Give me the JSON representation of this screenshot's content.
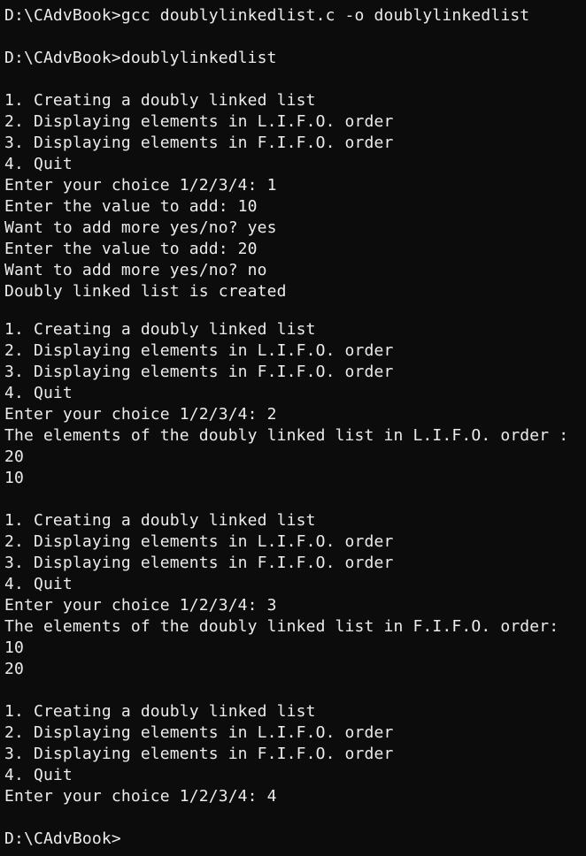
{
  "terminal": {
    "background": "#0c0c0c",
    "foreground": "#ececec",
    "lines": [
      "D:\\CAdvBook>gcc doublylinkedlist.c -o doublylinkedlist",
      "D:\\CAdvBook>doublylinkedlist",
      "1. Creating a doubly linked list",
      "2. Displaying elements in L.I.F.O. order",
      "3. Displaying elements in F.I.F.O. order",
      "4. Quit",
      "Enter your choice 1/2/3/4: 1",
      "Enter the value to add: 10",
      "Want to add more yes/no? yes",
      "Enter the value to add: 20",
      "Want to add more yes/no? no",
      "Doubly linked list is created",
      "1. Creating a doubly linked list",
      "2. Displaying elements in L.I.F.O. order",
      "3. Displaying elements in F.I.F.O. order",
      "4. Quit",
      "Enter your choice 1/2/3/4: 2",
      "The elements of the doubly linked list in L.I.F.O. order :",
      "20",
      "10",
      "1. Creating a doubly linked list",
      "2. Displaying elements in L.I.F.O. order",
      "3. Displaying elements in F.I.F.O. order",
      "4. Quit",
      "Enter your choice 1/2/3/4: 3",
      "The elements of the doubly linked list in F.I.F.O. order:",
      "10",
      "20",
      "1. Creating a doubly linked list",
      "2. Displaying elements in L.I.F.O. order",
      "3. Displaying elements in F.I.F.O. order",
      "4. Quit",
      "Enter your choice 1/2/3/4: 4",
      "D:\\CAdvBook>"
    ]
  }
}
